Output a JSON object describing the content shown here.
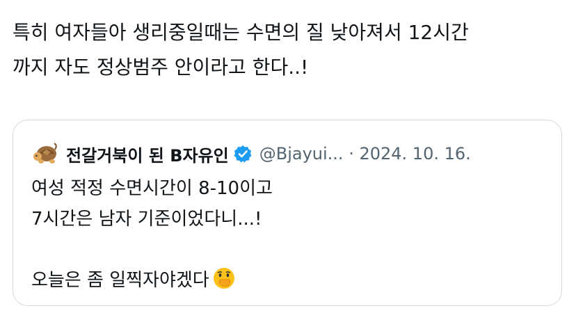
{
  "tweet": {
    "text_lines": [
      "특히 여자들아 생리중일때는 수면의 질 낮아져서 12시간",
      "까지 자도 정상범주 안이라고 한다..!"
    ]
  },
  "quote": {
    "display_name": "전갈거북이 된 B자유인",
    "handle": "@Bjayui...",
    "separator": "·",
    "date": "2024. 10. 16.",
    "body_lines": [
      "여성 적정 수면시간이 8-10이고",
      "7시간은 남자 기준이었다니...!",
      "",
      "오늘은 좀 일찍자야겠다"
    ],
    "icons": {
      "avatar": "turtle-avatar",
      "verified": "verified-badge-icon",
      "emoji": "face-with-hand-over-mouth-emoji"
    },
    "colors": {
      "verified_blue": "#1d9bf0",
      "secondary_text": "#536471",
      "border": "#cfd9de"
    }
  }
}
